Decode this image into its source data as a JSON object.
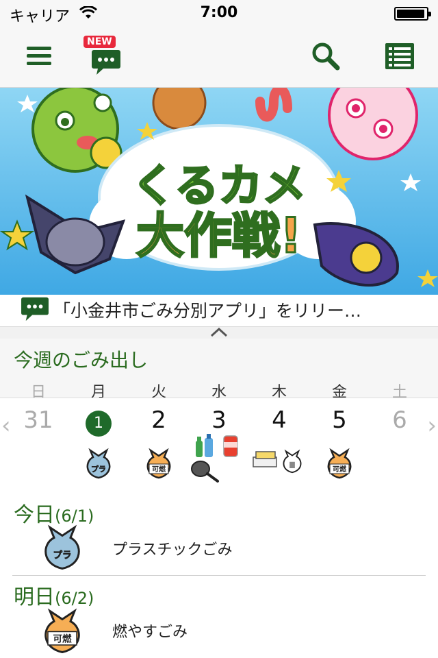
{
  "status_bar": {
    "carrier": "キャリア",
    "time": "7:00",
    "battery_level": 0.95
  },
  "toolbar": {
    "badge": "NEW",
    "icon_menu": "hamburger-menu-icon",
    "icon_messages": "chat-bubble-icon",
    "icon_search": "magnifier-icon",
    "icon_list": "list-view-icon",
    "accent_color": "#1f5e27"
  },
  "banner": {
    "title_line1": "くるカメ",
    "title_line2": "大作戦!"
  },
  "news": {
    "text": "「小金井市ごみ分別アプリ」をリリー…"
  },
  "week": {
    "title": "今週のごみ出し",
    "day_names": [
      "日",
      "月",
      "火",
      "水",
      "木",
      "金",
      "土"
    ],
    "dates": [
      "31",
      "1",
      "2",
      "3",
      "4",
      "5",
      "6"
    ],
    "prev_arrow": "‹",
    "next_arrow": "›",
    "bag_labels": {
      "mon": "プラ",
      "tue": "可燃",
      "fri": "可燃"
    }
  },
  "today": {
    "heading": "今日",
    "date": "(6/1)",
    "bag_label": "プラ",
    "item": "プラスチックごみ"
  },
  "tomorrow": {
    "heading": "明日",
    "date": "(6/2)",
    "bag_label": "可燃",
    "item": "燃やすごみ"
  },
  "colors": {
    "brand_green": "#1f5e27",
    "heading_green": "#2a6b1f",
    "plastic_bag": "#9cc3dc",
    "burnable_bag": "#f6ae55"
  }
}
